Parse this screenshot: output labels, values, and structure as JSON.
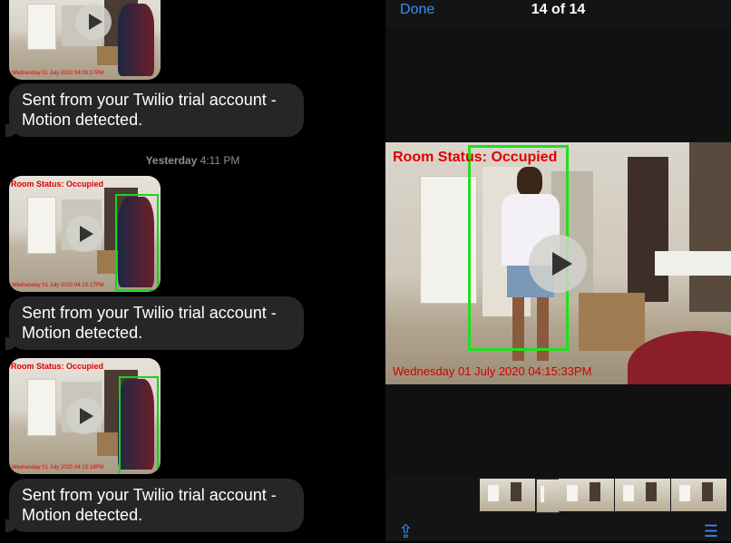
{
  "chat": {
    "timestamp": {
      "day": "Yesterday",
      "time": "4:11 PM"
    },
    "messages": [
      {
        "text": "Sent from your Twilio trial account - Motion detected."
      },
      {
        "text": "Sent from your Twilio trial account - Motion detected."
      },
      {
        "text": "Sent from your Twilio trial account - Motion detected."
      }
    ],
    "media": [
      {
        "overlay": "",
        "stamp": "Wednesday 01 July 2020 04:09:17PM",
        "icon": "play-icon"
      },
      {
        "overlay": "Room Status: Occupied",
        "stamp": "Wednesday 01 July 2020 04:15:17PM",
        "icon": "play-icon"
      },
      {
        "overlay": "Room Status: Occupied",
        "stamp": "Wednesday 01 July 2020 04:15:18PM",
        "icon": "play-icon"
      }
    ]
  },
  "viewer": {
    "done_label": "Done",
    "counter": "14 of 14",
    "video": {
      "overlay": "Room Status: Occupied",
      "stamp": "Wednesday 01 July 2020 04:15:33PM",
      "icon": "play-icon"
    },
    "toolbar": {
      "share_icon": "share-icon",
      "list_icon": "list-icon",
      "share_glyph": "⇪",
      "list_glyph": "☰"
    }
  },
  "colors": {
    "accent": "#3a8bff",
    "bubble": "#262628",
    "overlay_red": "#e00000",
    "bbox_green": "#1fe01f"
  }
}
